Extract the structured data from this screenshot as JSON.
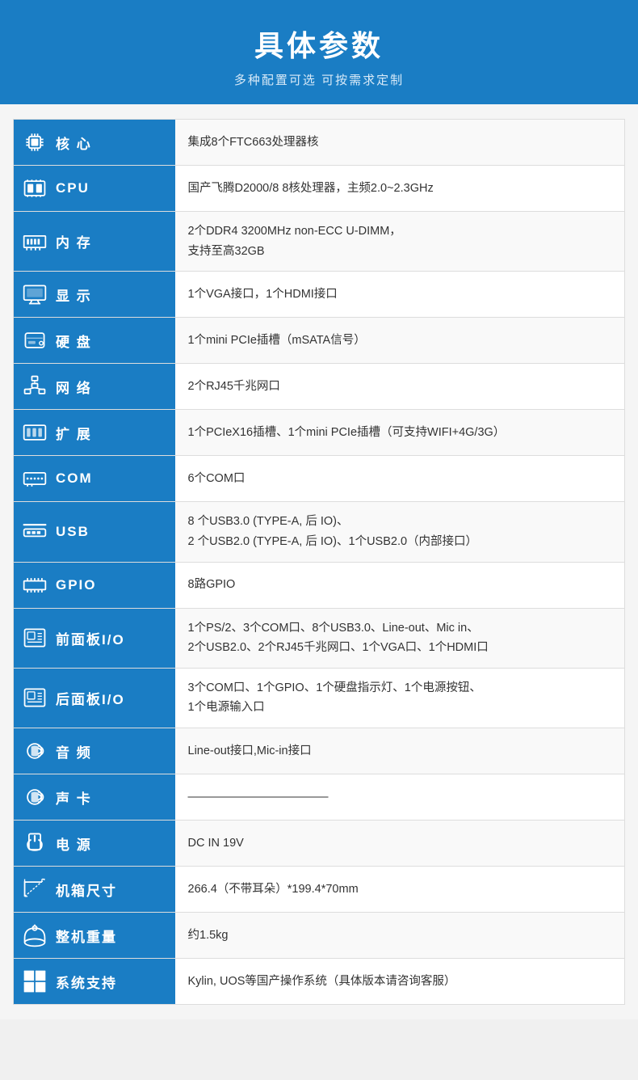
{
  "header": {
    "title": "具体参数",
    "subtitle": "多种配置可选 可按需求定制"
  },
  "rows": [
    {
      "id": "core",
      "icon": "cpu-chip-icon",
      "label": "核 心",
      "value": "集成8个FTC663处理器核"
    },
    {
      "id": "cpu",
      "icon": "cpu-icon",
      "label": "CPU",
      "value": "国产飞腾D2000/8  8核处理器，主频2.0~2.3GHz"
    },
    {
      "id": "memory",
      "icon": "memory-icon",
      "label": "内  存",
      "value": "2个DDR4 3200MHz non-ECC U-DIMM，\n支持至高32GB"
    },
    {
      "id": "display",
      "icon": "display-icon",
      "label": "显 示",
      "value": "1个VGA接口，1个HDMI接口"
    },
    {
      "id": "harddisk",
      "icon": "harddisk-icon",
      "label": "硬 盘",
      "value": "1个mini PCIe插槽（mSATA信号）"
    },
    {
      "id": "network",
      "icon": "network-icon",
      "label": "网 络",
      "value": "2个RJ45千兆网口"
    },
    {
      "id": "expansion",
      "icon": "expansion-icon",
      "label": "扩 展",
      "value": "1个PCIeX16插槽、1个mini PCIe插槽（可支持WIFI+4G/3G）"
    },
    {
      "id": "com",
      "icon": "com-icon",
      "label": "COM",
      "value": "6个COM口"
    },
    {
      "id": "usb",
      "icon": "usb-icon",
      "label": "USB",
      "value": "8 个USB3.0 (TYPE-A, 后 IO)、\n2 个USB2.0 (TYPE-A, 后 IO)、1个USB2.0（内部接口）"
    },
    {
      "id": "gpio",
      "icon": "gpio-icon",
      "label": "GPIO",
      "value": "8路GPIO"
    },
    {
      "id": "front-panel",
      "icon": "panel-icon",
      "label": "前面板I/O",
      "value": "1个PS/2、3个COM口、8个USB3.0、Line-out、Mic in、\n2个USB2.0、2个RJ45千兆网口、1个VGA口、1个HDMI口"
    },
    {
      "id": "rear-panel",
      "icon": "panel-icon",
      "label": "后面板I/O",
      "value": "3个COM口、1个GPIO、1个硬盘指示灯、1个电源按钮、\n1个电源输入口"
    },
    {
      "id": "audio",
      "icon": "audio-icon",
      "label": "音 频",
      "value": "Line-out接口,Mic-in接口"
    },
    {
      "id": "soundcard",
      "icon": "audio-icon",
      "label": "声 卡",
      "value": "————————————"
    },
    {
      "id": "power",
      "icon": "power-icon",
      "label": "电 源",
      "value": "DC IN 19V"
    },
    {
      "id": "dimension",
      "icon": "dimension-icon",
      "label": "机箱尺寸",
      "value": "266.4（不带耳朵）*199.4*70mm"
    },
    {
      "id": "weight",
      "icon": "weight-icon",
      "label": "整机重量",
      "value": "约1.5kg"
    },
    {
      "id": "os",
      "icon": "os-icon",
      "label": "系统支持",
      "value": "Kylin, UOS等国产操作系统（具体版本请咨询客服）"
    }
  ]
}
